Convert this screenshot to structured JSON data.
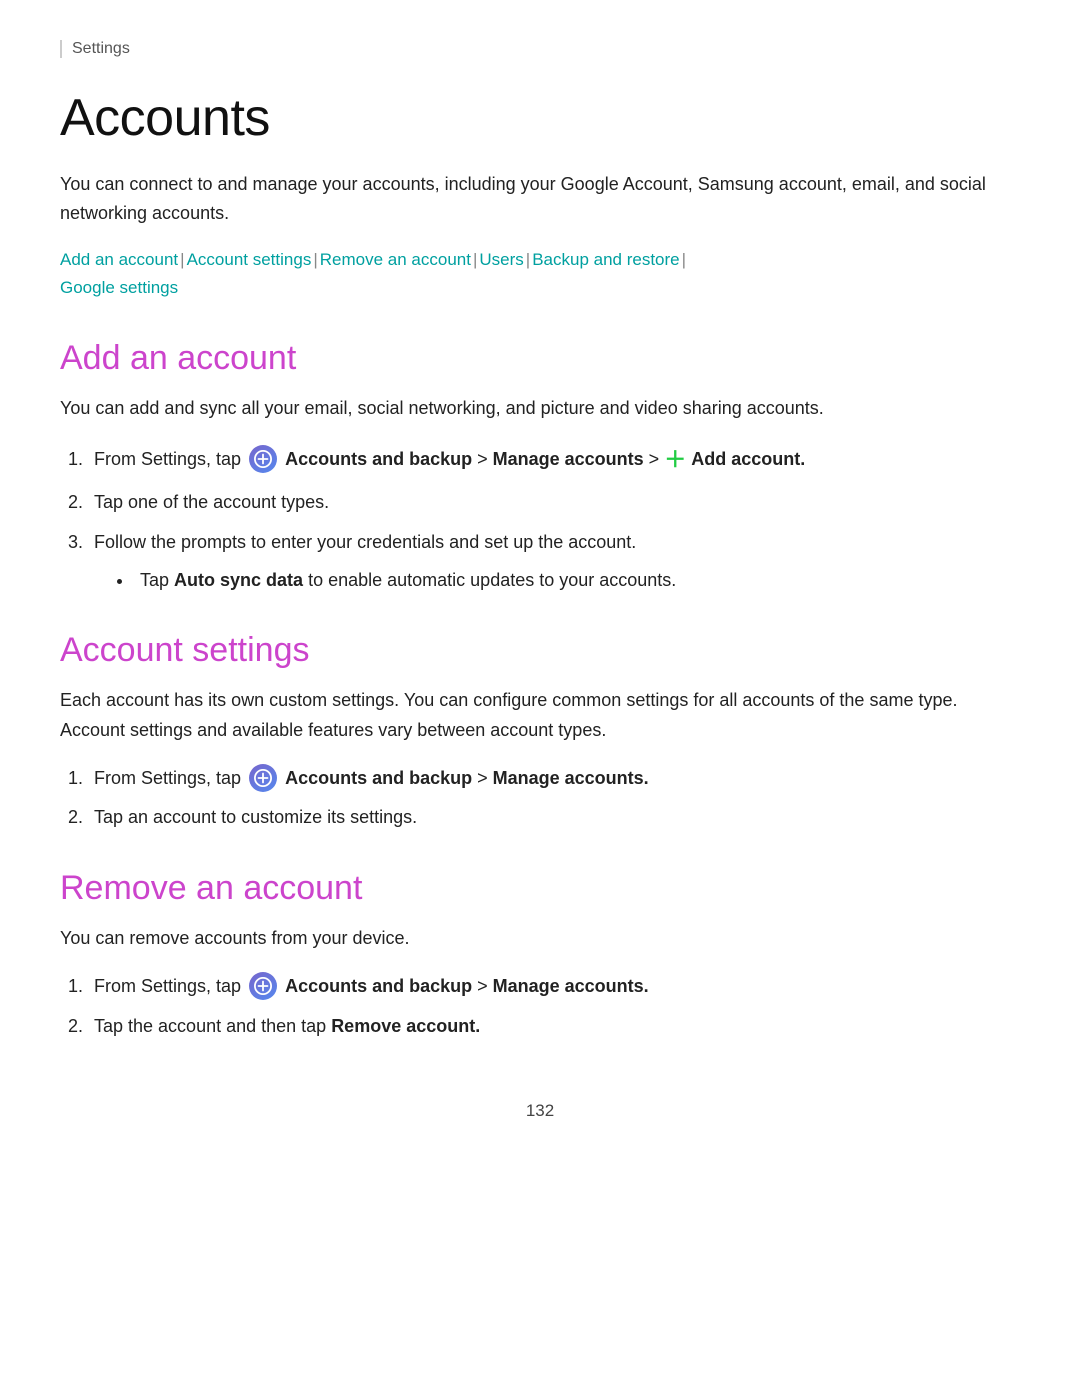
{
  "header": {
    "settings_label": "Settings"
  },
  "page": {
    "title": "Accounts",
    "intro": "You can connect to and manage your accounts, including your Google Account, Samsung account, email, and social networking accounts.",
    "nav_links": [
      {
        "label": "Add an account",
        "id": "add-an-account"
      },
      {
        "label": "Account settings",
        "id": "account-settings"
      },
      {
        "label": "Remove an account",
        "id": "remove-an-account"
      },
      {
        "label": "Users",
        "id": "users"
      },
      {
        "label": "Backup and restore",
        "id": "backup-and-restore"
      },
      {
        "label": "Google settings",
        "id": "google-settings"
      }
    ],
    "sections": [
      {
        "id": "add-an-account",
        "title": "Add an account",
        "desc": "You can add and sync all your email, social networking, and picture and video sharing accounts.",
        "steps": [
          {
            "html": "From Settings, tap [icon] <b>Accounts and backup</b> > <b>Manage accounts</b> > [plus] <b>Add account.</b>",
            "type": "icon-step-add"
          },
          {
            "text": "Tap one of the account types.",
            "type": "plain"
          },
          {
            "text": "Follow the prompts to enter your credentials and set up the account.",
            "type": "plain",
            "bullets": [
              "Tap <b>Auto sync data</b> to enable automatic updates to your accounts."
            ]
          }
        ]
      },
      {
        "id": "account-settings",
        "title": "Account settings",
        "desc": "Each account has its own custom settings. You can configure common settings for all accounts of the same type. Account settings and available features vary between account types.",
        "steps": [
          {
            "html": "From Settings, tap [icon] <b>Accounts and backup</b> > <b>Manage accounts.</b>",
            "type": "icon-step"
          },
          {
            "text": "Tap an account to customize its settings.",
            "type": "plain"
          }
        ]
      },
      {
        "id": "remove-an-account",
        "title": "Remove an account",
        "desc": "You can remove accounts from your device.",
        "steps": [
          {
            "html": "From Settings, tap [icon] <b>Accounts and backup</b> > <b>Manage accounts.</b>",
            "type": "icon-step"
          },
          {
            "text": "Tap the account and then tap <b>Remove account.</b>",
            "type": "plain-bold-end"
          }
        ]
      }
    ],
    "page_number": "132"
  }
}
